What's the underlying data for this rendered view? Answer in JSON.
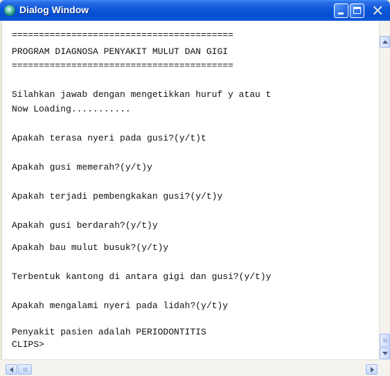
{
  "window": {
    "title": "Dialog Window",
    "icon": "app-icon",
    "title_bar_color": "#0a58d8",
    "buttons": {
      "minimize": "minimize-icon",
      "maximize": "maximize-icon",
      "close": "close-icon"
    }
  },
  "console": {
    "lines": [
      "=========================================",
      "PROGRAM DIAGNOSA PENYAKIT MULUT DAN GIGI",
      "=========================================",
      "Silahkan jawab dengan mengetikkan huruf y atau t",
      "Now Loading...........",
      "Apakah terasa nyeri pada gusi?(y/t)t",
      "Apakah gusi memerah?(y/t)y",
      "Apakah terjadi pembengkakan gusi?(y/t)y",
      "Apakah gusi berdarah?(y/t)y",
      "Apakah bau mulut busuk?(y/t)y",
      "Terbentuk kantong di antara gigi dan gusi?(y/t)y",
      "Apakah mengalami nyeri pada lidah?(y/t)y",
      "Penyakit pasien adalah PERIODONTITIS",
      "CLIPS>"
    ]
  },
  "scrollbars": {
    "vertical": {
      "up": "scroll-up-arrow-icon",
      "down": "scroll-down-arrow-icon",
      "position": 1.0
    },
    "horizontal": {
      "left": "scroll-left-arrow-icon",
      "right": "scroll-right-arrow-icon",
      "position": 0.0
    }
  }
}
